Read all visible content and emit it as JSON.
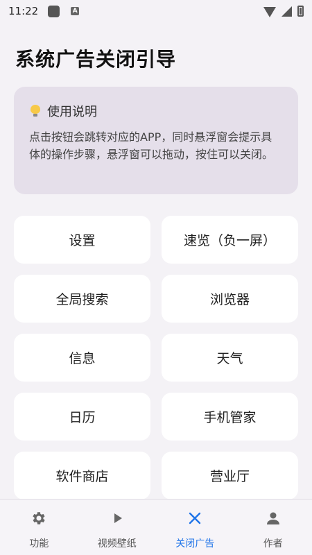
{
  "status_bar": {
    "time": "11:22",
    "a_badge": "A"
  },
  "title": "系统广告关闭引导",
  "tip": {
    "heading": "使用说明",
    "body": "点击按钮会跳转对应的APP，同时悬浮窗会提示具体的操作步骤，悬浮窗可以拖动，按住可以关闭。"
  },
  "buttons": [
    "设置",
    "速览（负一屏）",
    "全局搜索",
    "浏览器",
    "信息",
    "天气",
    "日历",
    "手机管家",
    "软件商店",
    "营业厅"
  ],
  "nav": [
    {
      "label": "功能",
      "icon": "gear-icon"
    },
    {
      "label": "视频壁纸",
      "icon": "play-icon"
    },
    {
      "label": "关闭广告",
      "icon": "close-icon",
      "active": true
    },
    {
      "label": "作者",
      "icon": "person-icon"
    }
  ],
  "colors": {
    "accent": "#1e73e8",
    "tip_bg": "#e5dfea",
    "page_bg": "#f4f2f6"
  }
}
